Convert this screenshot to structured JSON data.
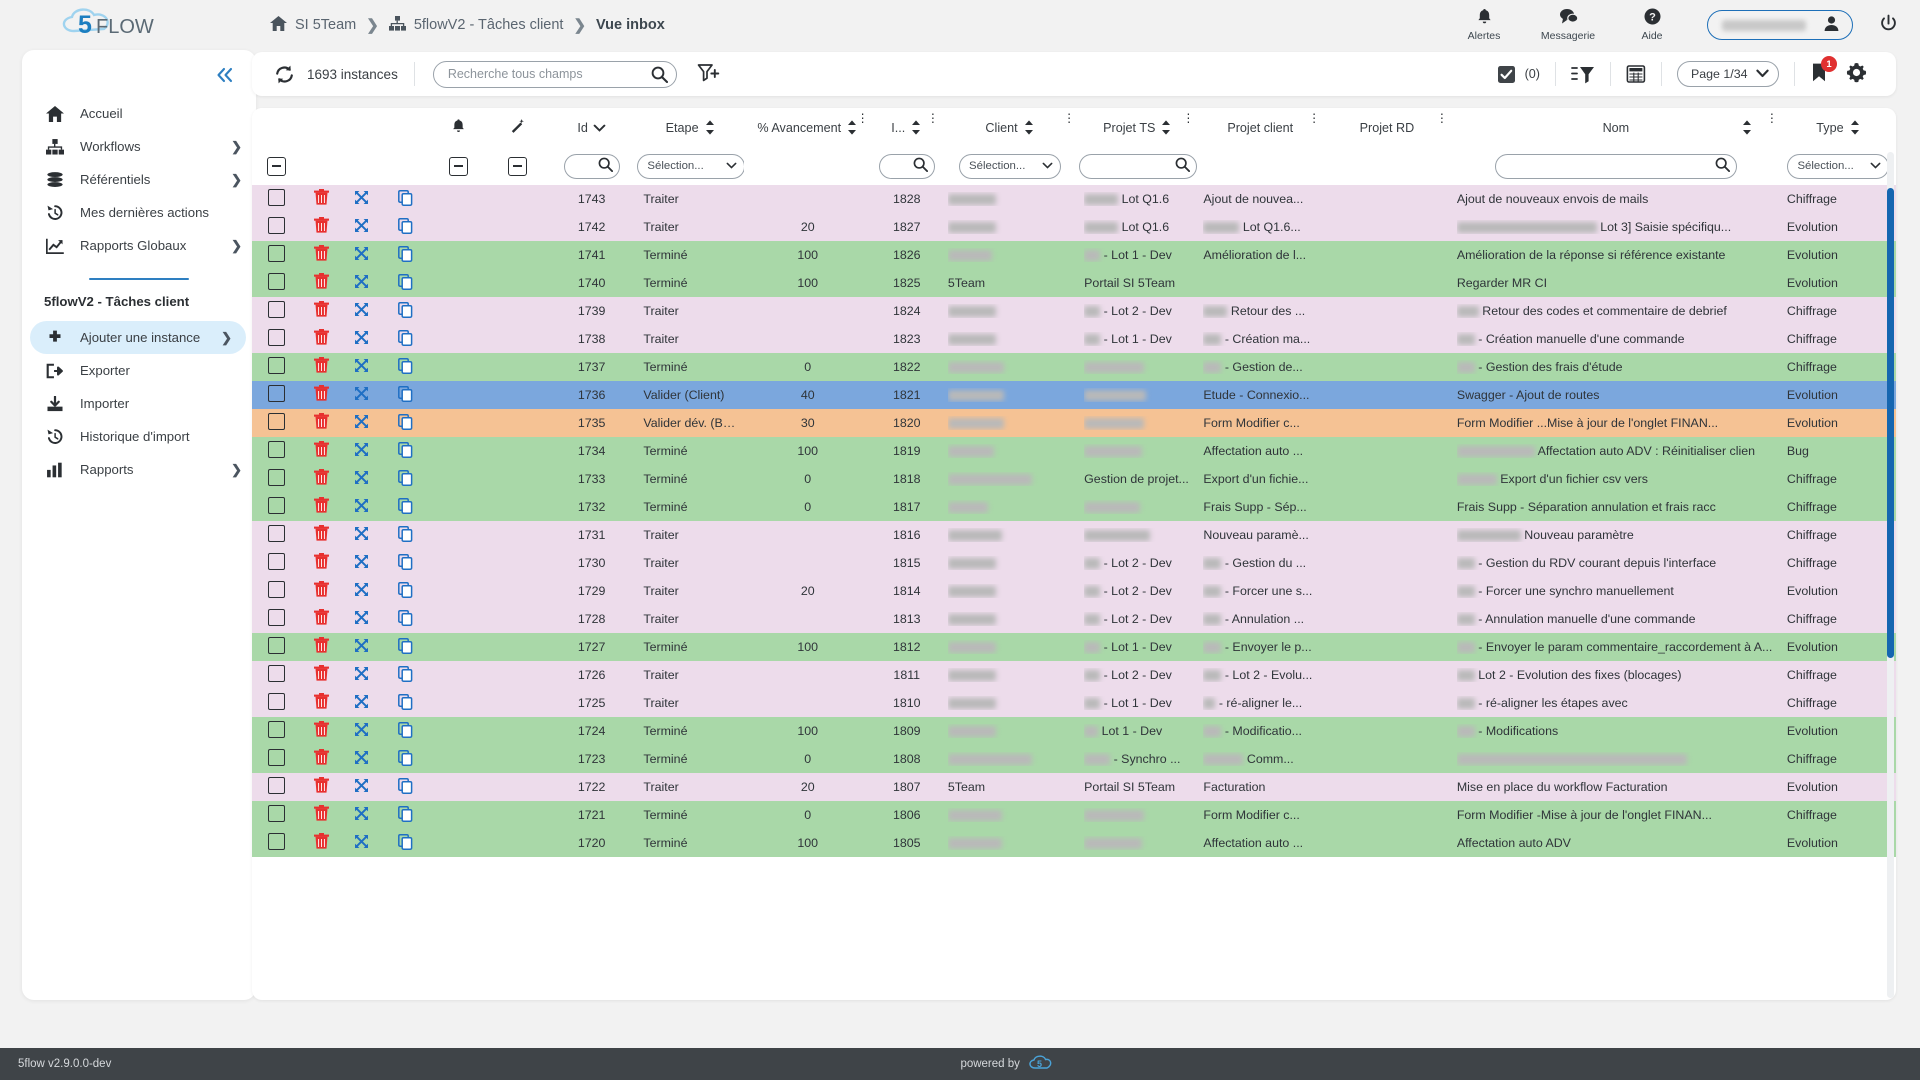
{
  "app": {
    "logo_text_1": "5",
    "logo_text_2": "FLOW",
    "footer_version": "5flow v2.9.0.0-dev",
    "footer_powered": "powered by"
  },
  "breadcrumb": {
    "home_icon": "home-icon",
    "items": [
      {
        "label": "SI 5Team",
        "icon": "home-icon"
      },
      {
        "label": "5flowV2 - Tâches client",
        "icon": "sitemap-icon"
      },
      {
        "label": "Vue inbox",
        "icon": ""
      }
    ]
  },
  "topright": {
    "alerts": "Alertes",
    "messaging": "Messagerie",
    "help": "Aide",
    "user_name": "",
    "power_icon": "power-icon"
  },
  "sidebar": {
    "collapse_icon": "chevron-double-left-icon",
    "items": [
      {
        "label": "Accueil",
        "icon": "home-icon",
        "chevron": false
      },
      {
        "label": "Workflows",
        "icon": "sitemap-icon",
        "chevron": true
      },
      {
        "label": "Référentiels",
        "icon": "database-icon",
        "chevron": true
      },
      {
        "label": "Mes dernières actions",
        "icon": "history-icon",
        "chevron": false
      },
      {
        "label": "Rapports Globaux",
        "icon": "chart-line-icon",
        "chevron": true
      }
    ],
    "section_title": "5flowV2 - Tâches client",
    "section_items": [
      {
        "label": "Ajouter une instance",
        "icon": "plus-icon",
        "chevron": true,
        "active": true
      },
      {
        "label": "Exporter",
        "icon": "export-icon",
        "chevron": false,
        "active": false
      },
      {
        "label": "Importer",
        "icon": "import-icon",
        "chevron": false,
        "active": false
      },
      {
        "label": "Historique d'import",
        "icon": "history-icon",
        "chevron": false,
        "active": false
      },
      {
        "label": "Rapports",
        "icon": "chart-bar-icon",
        "chevron": true,
        "active": false
      }
    ]
  },
  "toolbar": {
    "refresh_icon": "refresh-icon",
    "instances_count": "1693 instances",
    "search_placeholder": "Recherche tous champs",
    "search_value": "",
    "search_icon": "search-icon",
    "filter_add_icon": "filter-plus-icon",
    "selection_count": "(0)",
    "checkbox_icon": "checkbox-checked-icon",
    "filter_list_icon": "filter-list-icon",
    "calculator_icon": "calculator-icon",
    "page_label": "Page 1/34",
    "bookmark_icon": "bookmark-icon",
    "bookmark_badge": "1",
    "gear_icon": "gear-icon"
  },
  "table": {
    "columns": [
      {
        "key": "select",
        "label": "",
        "sort": false,
        "kebab": false,
        "filter": "minus"
      },
      {
        "key": "delete",
        "label": "",
        "sort": false,
        "kebab": false,
        "filter": "none"
      },
      {
        "key": "move",
        "label": "",
        "sort": false,
        "kebab": false,
        "filter": "none"
      },
      {
        "key": "copy",
        "label": "",
        "sort": false,
        "kebab": false,
        "filter": "none"
      },
      {
        "key": "alert",
        "label": "",
        "sort": false,
        "kebab": false,
        "filter": "minus",
        "icon": "bell-icon"
      },
      {
        "key": "magic",
        "label": "",
        "sort": false,
        "kebab": false,
        "filter": "minus",
        "icon": "magic-wand-icon"
      },
      {
        "key": "id",
        "label": "Id",
        "sort": "down",
        "kebab": false,
        "filter": "search"
      },
      {
        "key": "etape",
        "label": "Etape",
        "sort": true,
        "kebab": false,
        "filter": "select"
      },
      {
        "key": "avancement",
        "label": "% Avancement",
        "sort": true,
        "kebab": true,
        "filter": "none"
      },
      {
        "key": "i",
        "label": "I...",
        "sort": true,
        "kebab": true,
        "filter": "search"
      },
      {
        "key": "client",
        "label": "Client",
        "sort": true,
        "kebab": true,
        "filter": "select"
      },
      {
        "key": "projet_ts",
        "label": "Projet TS",
        "sort": true,
        "kebab": true,
        "filter": "searchwide"
      },
      {
        "key": "projet_client",
        "label": "Projet client",
        "sort": false,
        "kebab": true,
        "filter": "none"
      },
      {
        "key": "projet_rd",
        "label": "Projet RD",
        "sort": false,
        "kebab": true,
        "filter": "none"
      },
      {
        "key": "nom",
        "label": "Nom",
        "sort": true,
        "kebab": true,
        "filter": "searchxwide"
      },
      {
        "key": "type",
        "label": "Type",
        "sort": true,
        "kebab": false,
        "filter": "select"
      }
    ],
    "filter_select_placeholder": "Sélection...",
    "rows": [
      {
        "color": "pink",
        "id": "1743",
        "etape": "Traiter",
        "avancement": "",
        "i": "1828",
        "client": "",
        "client_blur": 48,
        "projet_ts": "Lot Q1.6",
        "projet_ts_blur": 34,
        "projet_client": "Ajout de nouvea...",
        "pc_blur": 0,
        "nom": "Ajout de nouveaux envois de mails",
        "nom_blur": 0,
        "type": "Chiffrage"
      },
      {
        "color": "pink",
        "id": "1742",
        "etape": "Traiter",
        "avancement": "20",
        "i": "1827",
        "client": "",
        "client_blur": 48,
        "projet_ts": "Lot Q1.6",
        "projet_ts_blur": 34,
        "projet_client": "Lot Q1.6...",
        "pc_blur": 36,
        "nom": "Lot 3] Saisie spécifiqu...",
        "nom_blur": 140,
        "type": "Evolution"
      },
      {
        "color": "green",
        "id": "1741",
        "etape": "Terminé",
        "avancement": "100",
        "i": "1826",
        "client": "",
        "client_blur": 44,
        "projet_ts": "- Lot 1 - Dev",
        "projet_ts_blur": 16,
        "projet_client": "Amélioration de l...",
        "pc_blur": 0,
        "nom": "Amélioration de la réponse si référence existante",
        "nom_blur": 0,
        "type": "Evolution"
      },
      {
        "color": "green",
        "id": "1740",
        "etape": "Terminé",
        "avancement": "100",
        "i": "1825",
        "client": "5Team",
        "client_blur": 0,
        "projet_ts": "Portail SI 5Team",
        "projet_ts_blur": 0,
        "projet_client": "",
        "pc_blur": 0,
        "nom": "Regarder MR CI",
        "nom_blur": 0,
        "type": "Evolution"
      },
      {
        "color": "pink",
        "id": "1739",
        "etape": "Traiter",
        "avancement": "",
        "i": "1824",
        "client": "",
        "client_blur": 48,
        "projet_ts": "- Lot 2 - Dev",
        "projet_ts_blur": 16,
        "projet_client": "Retour des ...",
        "pc_blur": 24,
        "nom": "Retour des codes et commentaire de debrief",
        "nom_blur": 22,
        "type": "Chiffrage"
      },
      {
        "color": "pink",
        "id": "1738",
        "etape": "Traiter",
        "avancement": "",
        "i": "1823",
        "client": "",
        "client_blur": 48,
        "projet_ts": "- Lot 1 - Dev",
        "projet_ts_blur": 16,
        "projet_client": "- Création ma...",
        "pc_blur": 18,
        "nom": "- Création manuelle d'une commande",
        "nom_blur": 18,
        "type": "Chiffrage"
      },
      {
        "color": "green",
        "id": "1737",
        "etape": "Terminé",
        "avancement": "0",
        "i": "1822",
        "client": "",
        "client_blur": 56,
        "projet_ts": "",
        "projet_ts_blur": 60,
        "projet_client": "- Gestion de...",
        "pc_blur": 18,
        "nom": "- Gestion des frais d'étude",
        "nom_blur": 18,
        "type": "Chiffrage"
      },
      {
        "color": "blue",
        "id": "1736",
        "etape": "Valider (Client)",
        "avancement": "40",
        "i": "1821",
        "client": "",
        "client_blur": 56,
        "projet_ts": "",
        "projet_ts_blur": 62,
        "projet_client": "Etude - Connexio...",
        "pc_blur": 0,
        "nom": "Swagger - Ajout de routes",
        "nom_blur": 0,
        "type": "Evolution"
      },
      {
        "color": "orange",
        "id": "1735",
        "etape": "Valider dév. (Binôme)",
        "avancement": "30",
        "i": "1820",
        "client": "",
        "client_blur": 56,
        "projet_ts": "",
        "projet_ts_blur": 60,
        "projet_client": "Form Modifier c...",
        "pc_blur": 0,
        "nom": "Form Modifier    ...Mise à jour de l'onglet FINAN...",
        "nom_blur": 0,
        "type": "Evolution"
      },
      {
        "color": "green",
        "id": "1734",
        "etape": "Terminé",
        "avancement": "100",
        "i": "1819",
        "client": "",
        "client_blur": 46,
        "projet_ts": "",
        "projet_ts_blur": 58,
        "projet_client": "Affectation auto ...",
        "pc_blur": 0,
        "nom": "Affectation auto ADV : Réinitialiser clien",
        "nom_blur": 78,
        "type": "Bug"
      },
      {
        "color": "green",
        "id": "1733",
        "etape": "Terminé",
        "avancement": "0",
        "i": "1818",
        "client": "",
        "client_blur": 84,
        "projet_ts": "Gestion de projet...",
        "projet_ts_blur": 0,
        "projet_client": "Export d'un fichie...",
        "pc_blur": 0,
        "nom": "Export d'un fichier csv vers",
        "nom_blur": 40,
        "type": "Chiffrage"
      },
      {
        "color": "green",
        "id": "1732",
        "etape": "Terminé",
        "avancement": "0",
        "i": "1817",
        "client": "",
        "client_blur": 40,
        "projet_ts": "",
        "projet_ts_blur": 56,
        "projet_client": "Frais Supp - Sép...",
        "pc_blur": 0,
        "nom": "Frais Supp - Séparation annulation et frais racc",
        "nom_blur": 0,
        "type": "Chiffrage"
      },
      {
        "color": "pink",
        "id": "1731",
        "etape": "Traiter",
        "avancement": "",
        "i": "1816",
        "client": "",
        "client_blur": 54,
        "projet_ts": "",
        "projet_ts_blur": 66,
        "projet_client": "Nouveau paramè...",
        "pc_blur": 0,
        "nom": "Nouveau paramètre",
        "nom_blur": 64,
        "type": "Chiffrage"
      },
      {
        "color": "pink",
        "id": "1730",
        "etape": "Traiter",
        "avancement": "",
        "i": "1815",
        "client": "",
        "client_blur": 48,
        "projet_ts": "- Lot 2 - Dev",
        "projet_ts_blur": 16,
        "projet_client": "- Gestion du ...",
        "pc_blur": 18,
        "nom": "- Gestion du RDV courant depuis l'interface",
        "nom_blur": 18,
        "type": "Chiffrage"
      },
      {
        "color": "pink",
        "id": "1729",
        "etape": "Traiter",
        "avancement": "20",
        "i": "1814",
        "client": "",
        "client_blur": 48,
        "projet_ts": "- Lot 2 - Dev",
        "projet_ts_blur": 16,
        "projet_client": "- Forcer une s...",
        "pc_blur": 18,
        "nom": "- Forcer une synchro manuellement",
        "nom_blur": 18,
        "type": "Evolution"
      },
      {
        "color": "pink",
        "id": "1728",
        "etape": "Traiter",
        "avancement": "",
        "i": "1813",
        "client": "",
        "client_blur": 48,
        "projet_ts": "- Lot 2 - Dev",
        "projet_ts_blur": 16,
        "projet_client": "- Annulation ...",
        "pc_blur": 18,
        "nom": "- Annulation manuelle d'une commande",
        "nom_blur": 18,
        "type": "Chiffrage"
      },
      {
        "color": "green",
        "id": "1727",
        "etape": "Terminé",
        "avancement": "100",
        "i": "1812",
        "client": "",
        "client_blur": 48,
        "projet_ts": "- Lot 1 - Dev",
        "projet_ts_blur": 16,
        "projet_client": "- Envoyer le p...",
        "pc_blur": 18,
        "nom": "- Envoyer le param commentaire_raccordement à A...",
        "nom_blur": 18,
        "type": "Evolution"
      },
      {
        "color": "pink",
        "id": "1726",
        "etape": "Traiter",
        "avancement": "",
        "i": "1811",
        "client": "",
        "client_blur": 48,
        "projet_ts": "- Lot 2 - Dev",
        "projet_ts_blur": 16,
        "projet_client": "- Lot 2 - Evolu...",
        "pc_blur": 18,
        "nom": "Lot 2 - Evolution des fixes (blocages)",
        "nom_blur": 18,
        "type": "Chiffrage"
      },
      {
        "color": "pink",
        "id": "1725",
        "etape": "Traiter",
        "avancement": "",
        "i": "1810",
        "client": "",
        "client_blur": 48,
        "projet_ts": "- Lot 1 - Dev",
        "projet_ts_blur": 16,
        "projet_client": "- ré-aligner le...",
        "pc_blur": 12,
        "nom": "- ré-aligner les étapes avec",
        "nom_blur": 18,
        "type": "Chiffrage"
      },
      {
        "color": "green",
        "id": "1724",
        "etape": "Terminé",
        "avancement": "100",
        "i": "1809",
        "client": "",
        "client_blur": 48,
        "projet_ts": "Lot 1 - Dev",
        "projet_ts_blur": 14,
        "projet_client": "- Modificatio...",
        "pc_blur": 18,
        "nom": "- Modifications",
        "nom_blur": 18,
        "type": "Evolution"
      },
      {
        "color": "green",
        "id": "1723",
        "etape": "Terminé",
        "avancement": "0",
        "i": "1808",
        "client": "",
        "client_blur": 84,
        "projet_ts": "- Synchro ...",
        "projet_ts_blur": 26,
        "projet_client": "Comm...",
        "pc_blur": 40,
        "nom": "",
        "nom_blur": 230,
        "type": "Chiffrage"
      },
      {
        "color": "pink",
        "id": "1722",
        "etape": "Traiter",
        "avancement": "20",
        "i": "1807",
        "client": "5Team",
        "client_blur": 0,
        "projet_ts": "Portail SI 5Team",
        "projet_ts_blur": 0,
        "projet_client": "Facturation",
        "pc_blur": 0,
        "nom": "Mise en place du workflow Facturation",
        "nom_blur": 0,
        "type": "Evolution"
      },
      {
        "color": "green",
        "id": "1721",
        "etape": "Terminé",
        "avancement": "0",
        "i": "1806",
        "client": "",
        "client_blur": 54,
        "projet_ts": "",
        "projet_ts_blur": 60,
        "projet_client": "Form Modifier c...",
        "pc_blur": 0,
        "nom": "Form Modifier    -Mise à jour de l'onglet FINAN...",
        "nom_blur": 0,
        "type": "Chiffrage"
      },
      {
        "color": "green",
        "id": "1720",
        "etape": "Terminé",
        "avancement": "100",
        "i": "1805",
        "client": "",
        "client_blur": 54,
        "projet_ts": "",
        "projet_ts_blur": 58,
        "projet_client": "Affectation auto ...",
        "pc_blur": 0,
        "nom": "Affectation auto ADV",
        "type": "Evolution",
        "nom_blur": 0
      }
    ]
  }
}
